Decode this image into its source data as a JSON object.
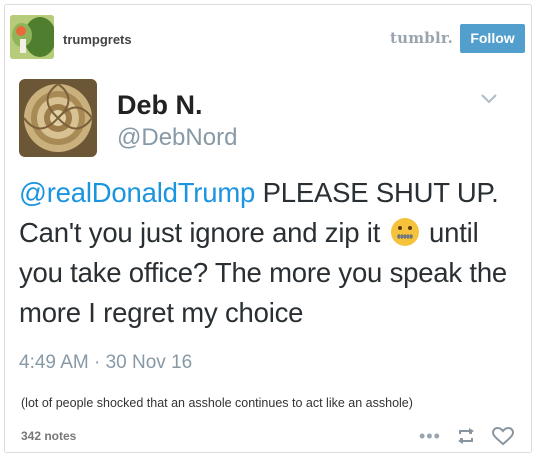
{
  "header": {
    "blog_name": "trumpgrets",
    "logo_text": "tumblr.",
    "follow_label": "Follow"
  },
  "tweet": {
    "name": "Deb N.",
    "handle": "@DebNord",
    "mention": "@realDonaldTrump",
    "text_part1": " PLEASE SHUT UP. Can't you just ignore and zip it",
    "emoji": "zipper-mouth-face-icon",
    "text_part2": " until you take office? The more you speak the more I regret my choice",
    "timestamp": "4:49 AM · 30 Nov 16"
  },
  "caption": "(lot of people shocked that an asshole continues to act like an asshole)",
  "footer": {
    "notes": "342 notes",
    "more_label": "•••"
  },
  "colors": {
    "accent": "#529ecc",
    "mention": "#1b95e0",
    "muted": "#8899a6"
  }
}
